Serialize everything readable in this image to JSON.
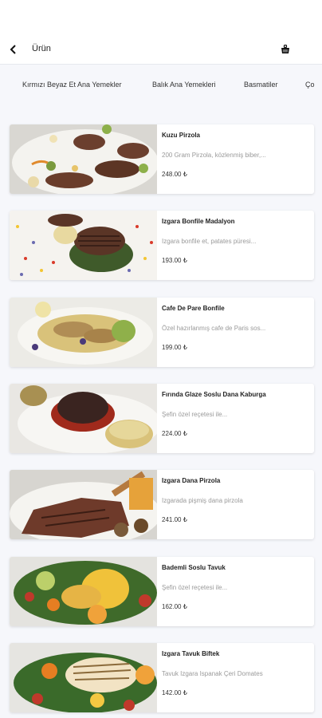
{
  "header": {
    "title": "Ürün",
    "back_icon": "chevron-left-icon",
    "basket_icon": "basket-icon"
  },
  "tabs": [
    {
      "label": "Kırmızı Beyaz Et Ana Yemekler"
    },
    {
      "label": "Balık Ana Yemekleri"
    },
    {
      "label": "Basmatiler"
    },
    {
      "label": "Ço"
    }
  ],
  "products": [
    {
      "name": "Kuzu Pirzola",
      "description": "200 Gram Pirzola, közlenmiş biber,...",
      "price": "248.00 ₺",
      "image": "lamb-chops-image"
    },
    {
      "name": "Izgara Bonfile Madalyon",
      "description": "Izgara bonfile et, patates püresi...",
      "price": "193.00 ₺",
      "image": "tenderloin-medallion-image"
    },
    {
      "name": "Cafe De Pare Bonfile",
      "description": "Özel hazırlanmış cafe de Paris sos...",
      "price": "199.00 ₺",
      "image": "cafe-de-paris-image"
    },
    {
      "name": "Fırında Glaze Soslu Dana Kaburga",
      "description": "Şefin özel reçetesi ile...",
      "price": "224.00 ₺",
      "image": "beef-rib-image"
    },
    {
      "name": "Izgara Dana Pirzola",
      "description": "Izgarada pişmiş dana pirzola",
      "price": "241.00 ₺",
      "image": "veal-chop-image"
    },
    {
      "name": "Bademli Soslu Tavuk",
      "description": "Şefin özel reçetesi ile...",
      "price": "162.00 ₺",
      "image": "almond-chicken-image"
    },
    {
      "name": "Izgara Tavuk Biftek",
      "description": "Tavuk Izgara Ispanak Çeri Domates",
      "price": "142.00 ₺",
      "image": "grilled-chicken-image"
    }
  ]
}
